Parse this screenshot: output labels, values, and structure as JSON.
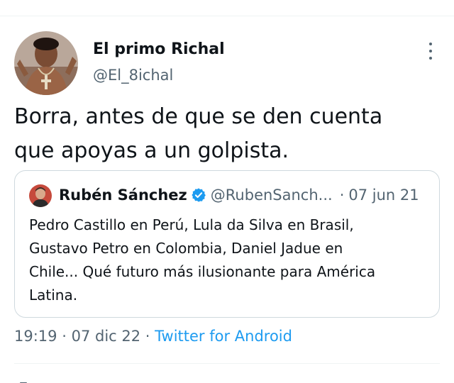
{
  "tweet": {
    "display_name": "El primo Richal",
    "handle": "@El_8ichal",
    "text_line1": "Borra, antes de que se den cuenta",
    "text_line2": "que apoyas a un golpista.",
    "time": "19:19",
    "date": "07 dic 22",
    "separator": "·",
    "source": "Twitter for Android"
  },
  "quote": {
    "display_name": "Rubén Sánchez",
    "handle": "@RubenSanch...",
    "separator": "·",
    "date": "07 jun 21",
    "text_line1": "Pedro Castillo en Perú, Lula da Silva en Brasil,",
    "text_line2": "Gustavo Petro en Colombia, Daniel Jadue en",
    "text_line3": "Chile... Qué futuro más ilusionante para América",
    "text_line4": "Latina."
  },
  "colors": {
    "link": "#1d9bf0",
    "muted": "#536471",
    "text": "#0f1419",
    "border": "#cfd9de"
  },
  "icons": {
    "more": "more-dots-icon",
    "verified": "verified-badge-icon"
  }
}
